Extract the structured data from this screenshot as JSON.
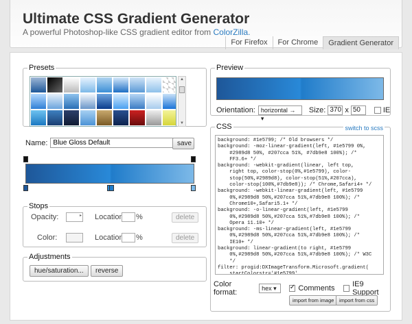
{
  "header": {
    "title": "Ultimate CSS Gradient Generator",
    "subtitle_prefix": "A powerful Photoshop-like CSS gradient editor from ",
    "subtitle_link": "ColorZilla.",
    "tabs": [
      "For Firefox",
      "For Chrome",
      "Gradient Generator"
    ]
  },
  "presets": {
    "legend": "Presets",
    "swatches": [
      "linear-gradient(#9fb8d6,#1e5799)",
      "linear-gradient(135deg,#000,#666)",
      "linear-gradient(#fff,#bbb)",
      "linear-gradient(#e8f3ff,#7db9e8)",
      "linear-gradient(#b0d4f1,#3c8fd6)",
      "linear-gradient(#d6e9fb,#1e6fc4)",
      "linear-gradient(#cfe3f7,#5b9ad6)",
      "linear-gradient(#eaf4fd,#8fc1ea)",
      "linear-gradient(45deg,#ccc 25%,#fff 25%,#fff 75%,#ccc 75%)",
      "linear-gradient(#b3d9ff,#2f7fd6)",
      "linear-gradient(#e6f0fa,#6ba4dd)",
      "linear-gradient(#8fc3ee,#2a6fb5)",
      "linear-gradient(#f2f7fc,#6b97c9)",
      "linear-gradient(#6fa6e0,#0b3c8c)",
      "linear-gradient(#d4ebff,#4aa0f0)",
      "linear-gradient(#b7d7f5,#3b7cc4)",
      "linear-gradient(#ffffff,#a7cbed)",
      "linear-gradient(#c9e2f8,#1a74d8)",
      "linear-gradient(#6ec2ef,#1a78c2)",
      "linear-gradient(#3e80c0,#1b3f72)",
      "linear-gradient(#2c3f6b,#111c33)",
      "linear-gradient(#a7d0f2,#4c93d6)",
      "linear-gradient(#c8a96e,#7a5a25)",
      "linear-gradient(#2a4f8f,#0c234e)",
      "linear-gradient(#cc2222,#6a0b0b)",
      "linear-gradient(#eeeeee,#999)",
      "linear-gradient(#f3f39a,#d6d63a)",
      "linear-gradient(#9ed46a,#4c9a1e)",
      "linear-gradient(#6ab04c,#2d6a14)",
      "linear-gradient(#2f8f3a,#145a1f)",
      "linear-gradient(#8fd36a,#3f9a25)",
      "linear-gradient(#b9e87a,#64b02a)",
      "linear-gradient(#7fd05c,#2d8f22)",
      "linear-gradient(#d8efc0,#7fc24a)",
      "linear-gradient(#c5e58a,#72ac2e)",
      "linear-gradient(#4ca64c,#1c6b1c)"
    ]
  },
  "name": {
    "label": "Name:",
    "value": "Blue Gloss Default",
    "save": "save"
  },
  "stops": {
    "legend": "Stops",
    "opacity": "Opacity:",
    "location": "Location:",
    "pct": "%",
    "color": "Color:",
    "delete": "delete"
  },
  "adjust": {
    "legend": "Adjustments",
    "hue": "hue/saturation...",
    "reverse": "reverse"
  },
  "preview": {
    "legend": "Preview",
    "orientation": "Orientation:",
    "orientation_value": "horizontal →",
    "size": "Size:",
    "w": "370",
    "x": "x",
    "h": "50",
    "ie": "IE"
  },
  "css": {
    "legend": "CSS",
    "scss": "switch to scss",
    "code": "background: #1e5799; /* Old browsers */\nbackground: -moz-linear-gradient(left, #1e5799 0%,\n    #2989d8 50%, #207cca 51%, #7db9e8 100%); /*\n    FF3.6+ */\nbackground: -webkit-gradient(linear, left top,\n    right top, color-stop(0%,#1e5799), color-\n    stop(50%,#2989d8), color-stop(51%,#207cca),\n    color-stop(100%,#7db9e8)); /* Chrome,Safari4+ */\nbackground: -webkit-linear-gradient(left, #1e5799\n    0%,#2989d8 50%,#207cca 51%,#7db9e8 100%); /*\n    Chrome10+,Safari5.1+ */\nbackground: -o-linear-gradient(left, #1e5799\n    0%,#2989d8 50%,#207cca 51%,#7db9e8 100%); /*\n    Opera 11.10+ */\nbackground: -ms-linear-gradient(left, #1e5799\n    0%,#2989d8 50%,#207cca 51%,#7db9e8 100%); /*\n    IE10+ */\nbackground: linear-gradient(to right, #1e5799\n    0%,#2989d8 50%,#207cca 51%,#7db9e8 100%); /* W3C\n    */\nfilter: progid:DXImageTransform.Microsoft.gradient(\n    startColorstr='#1e5799',\n    endColorstr='#7db9e8',GradientType=1 ); /* IE6-9\n    */",
    "format_label": "Color format:",
    "format": "hex",
    "comments": "Comments",
    "ie9": "IE9 Support",
    "import_image": "import from image",
    "import_css": "import from css"
  },
  "colors": {
    "stop1": "#1e5799",
    "stop2": "#2989d8",
    "stop3": "#7db9e8",
    "link": "#2a7bc0"
  }
}
